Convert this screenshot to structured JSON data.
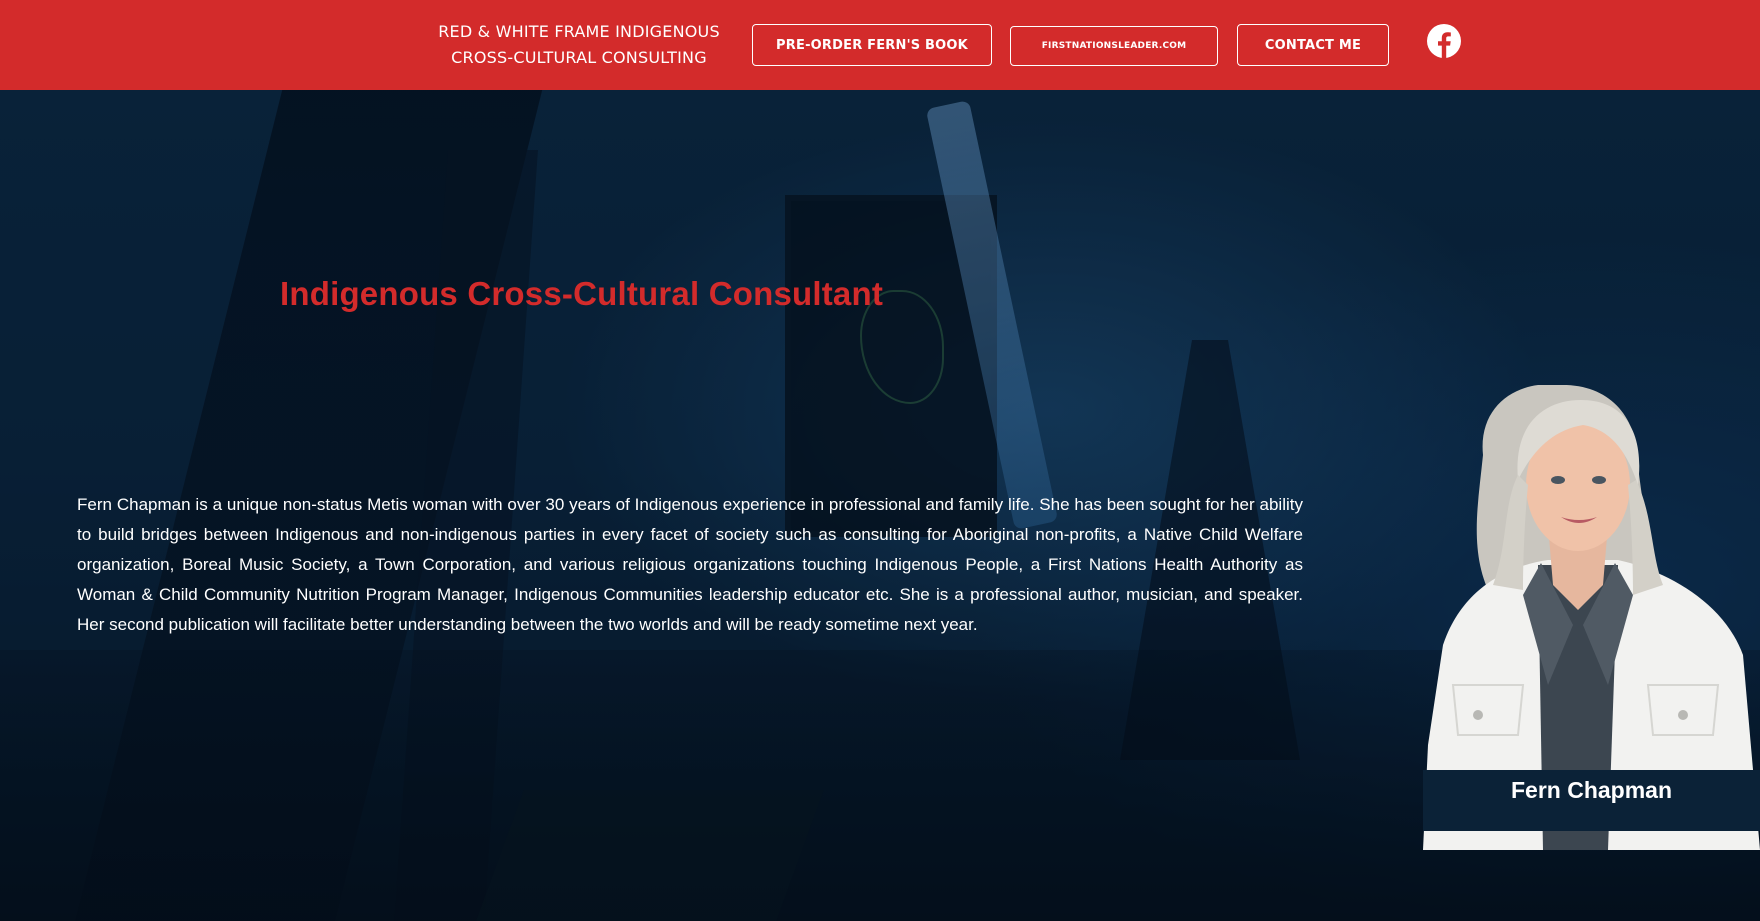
{
  "header": {
    "brand_line1": "RED & WHITE FRAME INDIGENOUS",
    "brand_line2": "CROSS-CULTURAL CONSULTING",
    "nav": {
      "preorder_label": "PRE-ORDER FERN'S BOOK",
      "site_label": "FIRSTNATIONSLEADER.COM",
      "contact_label": "CONTACT ME"
    },
    "social_icon": "facebook-icon"
  },
  "hero": {
    "title": "Indigenous Cross-Cultural Consultant",
    "bio": "Fern Chapman is a unique non-status Metis woman with over 30 years of Indigenous experience in professional and family life. She has been sought for her ability to build bridges between Indigenous and non-indigenous parties in every facet of society such as consulting for Aboriginal non-profits, a Native Child Welfare organization, Boreal Music Society, a Town Corporation, and various religious organizations touching Indigenous People, a First Nations Health Authority as Woman & Child Community Nutrition Program Manager, Indigenous Communities leadership educator etc. She is a professional author, musician, and speaker. Her second publication will facilitate better understanding between the two worlds and will be ready sometime next year."
  },
  "portrait": {
    "caption": "Fern Chapman"
  },
  "colors": {
    "header_red": "#d32b2b",
    "title_red": "#d32b2b",
    "hero_dark_blue": "#0b2740",
    "text_white": "#ffffff"
  }
}
